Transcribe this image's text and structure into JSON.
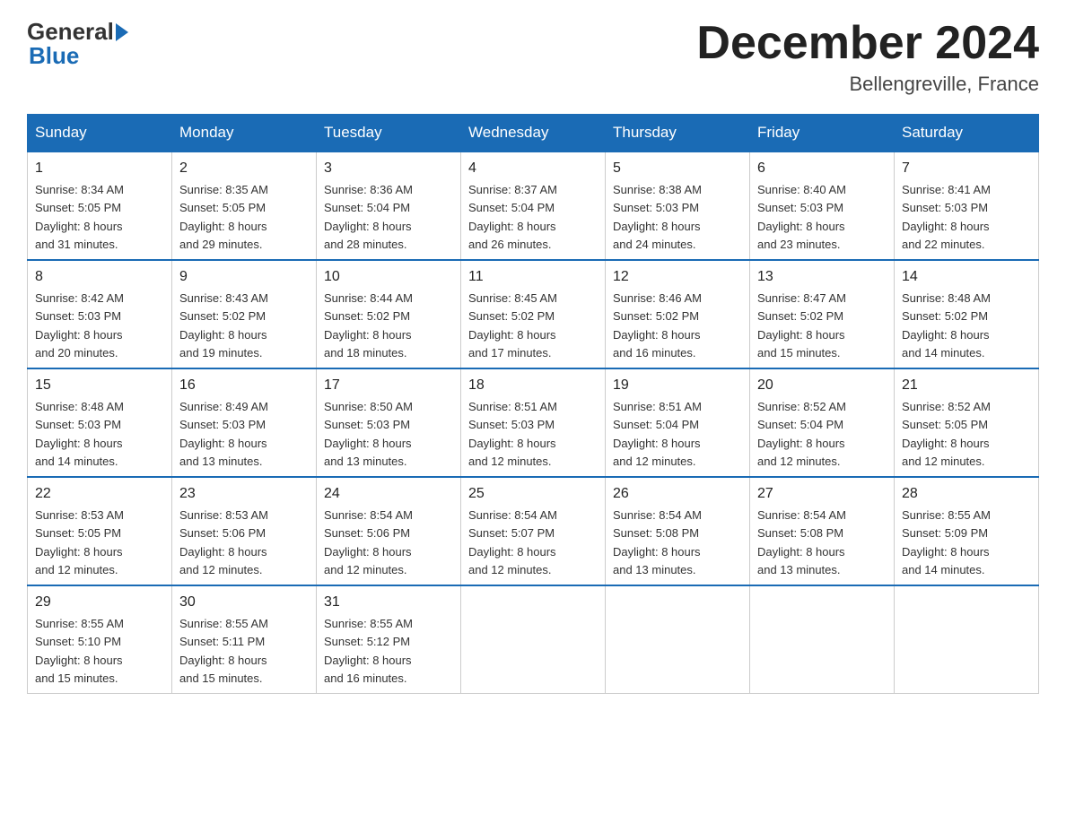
{
  "header": {
    "logo_general": "General",
    "logo_blue": "Blue",
    "title": "December 2024",
    "location": "Bellengreville, France"
  },
  "days_of_week": [
    "Sunday",
    "Monday",
    "Tuesday",
    "Wednesday",
    "Thursday",
    "Friday",
    "Saturday"
  ],
  "weeks": [
    [
      {
        "day": "1",
        "sunrise": "Sunrise: 8:34 AM",
        "sunset": "Sunset: 5:05 PM",
        "daylight": "Daylight: 8 hours",
        "minutes": "and 31 minutes."
      },
      {
        "day": "2",
        "sunrise": "Sunrise: 8:35 AM",
        "sunset": "Sunset: 5:05 PM",
        "daylight": "Daylight: 8 hours",
        "minutes": "and 29 minutes."
      },
      {
        "day": "3",
        "sunrise": "Sunrise: 8:36 AM",
        "sunset": "Sunset: 5:04 PM",
        "daylight": "Daylight: 8 hours",
        "minutes": "and 28 minutes."
      },
      {
        "day": "4",
        "sunrise": "Sunrise: 8:37 AM",
        "sunset": "Sunset: 5:04 PM",
        "daylight": "Daylight: 8 hours",
        "minutes": "and 26 minutes."
      },
      {
        "day": "5",
        "sunrise": "Sunrise: 8:38 AM",
        "sunset": "Sunset: 5:03 PM",
        "daylight": "Daylight: 8 hours",
        "minutes": "and 24 minutes."
      },
      {
        "day": "6",
        "sunrise": "Sunrise: 8:40 AM",
        "sunset": "Sunset: 5:03 PM",
        "daylight": "Daylight: 8 hours",
        "minutes": "and 23 minutes."
      },
      {
        "day": "7",
        "sunrise": "Sunrise: 8:41 AM",
        "sunset": "Sunset: 5:03 PM",
        "daylight": "Daylight: 8 hours",
        "minutes": "and 22 minutes."
      }
    ],
    [
      {
        "day": "8",
        "sunrise": "Sunrise: 8:42 AM",
        "sunset": "Sunset: 5:03 PM",
        "daylight": "Daylight: 8 hours",
        "minutes": "and 20 minutes."
      },
      {
        "day": "9",
        "sunrise": "Sunrise: 8:43 AM",
        "sunset": "Sunset: 5:02 PM",
        "daylight": "Daylight: 8 hours",
        "minutes": "and 19 minutes."
      },
      {
        "day": "10",
        "sunrise": "Sunrise: 8:44 AM",
        "sunset": "Sunset: 5:02 PM",
        "daylight": "Daylight: 8 hours",
        "minutes": "and 18 minutes."
      },
      {
        "day": "11",
        "sunrise": "Sunrise: 8:45 AM",
        "sunset": "Sunset: 5:02 PM",
        "daylight": "Daylight: 8 hours",
        "minutes": "and 17 minutes."
      },
      {
        "day": "12",
        "sunrise": "Sunrise: 8:46 AM",
        "sunset": "Sunset: 5:02 PM",
        "daylight": "Daylight: 8 hours",
        "minutes": "and 16 minutes."
      },
      {
        "day": "13",
        "sunrise": "Sunrise: 8:47 AM",
        "sunset": "Sunset: 5:02 PM",
        "daylight": "Daylight: 8 hours",
        "minutes": "and 15 minutes."
      },
      {
        "day": "14",
        "sunrise": "Sunrise: 8:48 AM",
        "sunset": "Sunset: 5:02 PM",
        "daylight": "Daylight: 8 hours",
        "minutes": "and 14 minutes."
      }
    ],
    [
      {
        "day": "15",
        "sunrise": "Sunrise: 8:48 AM",
        "sunset": "Sunset: 5:03 PM",
        "daylight": "Daylight: 8 hours",
        "minutes": "and 14 minutes."
      },
      {
        "day": "16",
        "sunrise": "Sunrise: 8:49 AM",
        "sunset": "Sunset: 5:03 PM",
        "daylight": "Daylight: 8 hours",
        "minutes": "and 13 minutes."
      },
      {
        "day": "17",
        "sunrise": "Sunrise: 8:50 AM",
        "sunset": "Sunset: 5:03 PM",
        "daylight": "Daylight: 8 hours",
        "minutes": "and 13 minutes."
      },
      {
        "day": "18",
        "sunrise": "Sunrise: 8:51 AM",
        "sunset": "Sunset: 5:03 PM",
        "daylight": "Daylight: 8 hours",
        "minutes": "and 12 minutes."
      },
      {
        "day": "19",
        "sunrise": "Sunrise: 8:51 AM",
        "sunset": "Sunset: 5:04 PM",
        "daylight": "Daylight: 8 hours",
        "minutes": "and 12 minutes."
      },
      {
        "day": "20",
        "sunrise": "Sunrise: 8:52 AM",
        "sunset": "Sunset: 5:04 PM",
        "daylight": "Daylight: 8 hours",
        "minutes": "and 12 minutes."
      },
      {
        "day": "21",
        "sunrise": "Sunrise: 8:52 AM",
        "sunset": "Sunset: 5:05 PM",
        "daylight": "Daylight: 8 hours",
        "minutes": "and 12 minutes."
      }
    ],
    [
      {
        "day": "22",
        "sunrise": "Sunrise: 8:53 AM",
        "sunset": "Sunset: 5:05 PM",
        "daylight": "Daylight: 8 hours",
        "minutes": "and 12 minutes."
      },
      {
        "day": "23",
        "sunrise": "Sunrise: 8:53 AM",
        "sunset": "Sunset: 5:06 PM",
        "daylight": "Daylight: 8 hours",
        "minutes": "and 12 minutes."
      },
      {
        "day": "24",
        "sunrise": "Sunrise: 8:54 AM",
        "sunset": "Sunset: 5:06 PM",
        "daylight": "Daylight: 8 hours",
        "minutes": "and 12 minutes."
      },
      {
        "day": "25",
        "sunrise": "Sunrise: 8:54 AM",
        "sunset": "Sunset: 5:07 PM",
        "daylight": "Daylight: 8 hours",
        "minutes": "and 12 minutes."
      },
      {
        "day": "26",
        "sunrise": "Sunrise: 8:54 AM",
        "sunset": "Sunset: 5:08 PM",
        "daylight": "Daylight: 8 hours",
        "minutes": "and 13 minutes."
      },
      {
        "day": "27",
        "sunrise": "Sunrise: 8:54 AM",
        "sunset": "Sunset: 5:08 PM",
        "daylight": "Daylight: 8 hours",
        "minutes": "and 13 minutes."
      },
      {
        "day": "28",
        "sunrise": "Sunrise: 8:55 AM",
        "sunset": "Sunset: 5:09 PM",
        "daylight": "Daylight: 8 hours",
        "minutes": "and 14 minutes."
      }
    ],
    [
      {
        "day": "29",
        "sunrise": "Sunrise: 8:55 AM",
        "sunset": "Sunset: 5:10 PM",
        "daylight": "Daylight: 8 hours",
        "minutes": "and 15 minutes."
      },
      {
        "day": "30",
        "sunrise": "Sunrise: 8:55 AM",
        "sunset": "Sunset: 5:11 PM",
        "daylight": "Daylight: 8 hours",
        "minutes": "and 15 minutes."
      },
      {
        "day": "31",
        "sunrise": "Sunrise: 8:55 AM",
        "sunset": "Sunset: 5:12 PM",
        "daylight": "Daylight: 8 hours",
        "minutes": "and 16 minutes."
      },
      null,
      null,
      null,
      null
    ]
  ]
}
